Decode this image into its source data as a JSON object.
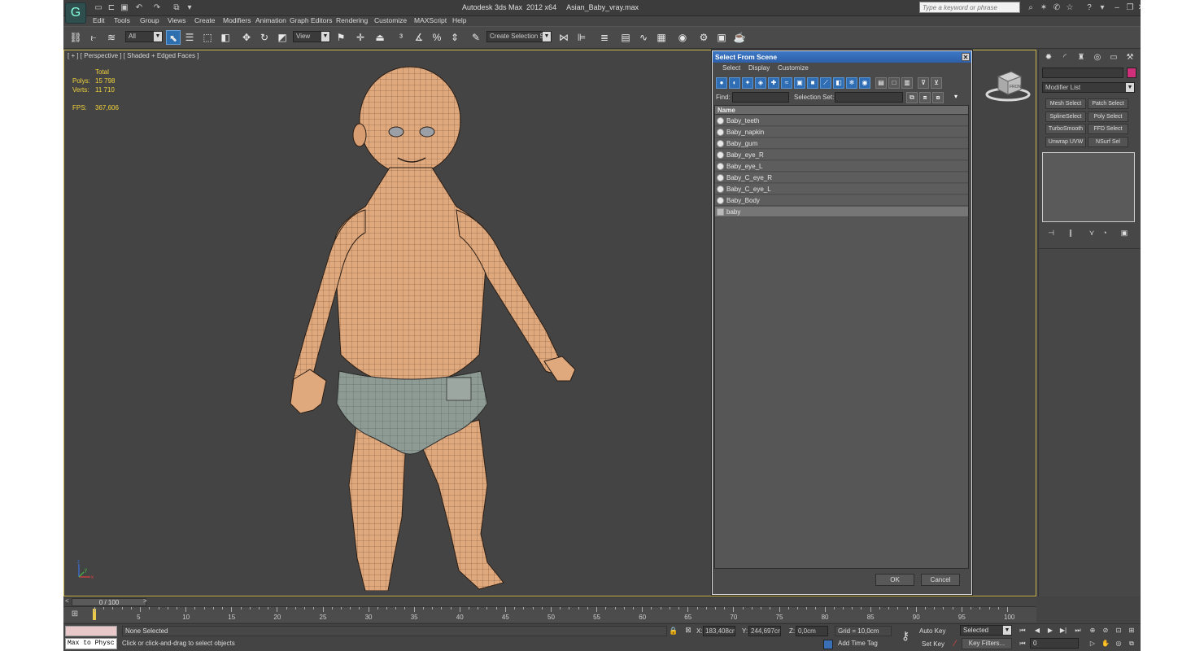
{
  "window": {
    "title": "Autodesk 3ds Max  2012 x64     Asian_Baby_vray.max",
    "search_placeholder": "Type a keyword or phrase",
    "logo_glyph": "G"
  },
  "menu": [
    "Edit",
    "Tools",
    "Group",
    "Views",
    "Create",
    "Modifiers",
    "Animation",
    "Graph Editors",
    "Rendering",
    "Customize",
    "MAXScript",
    "Help"
  ],
  "toolbar": {
    "filter_value": "All",
    "refcoord_value": "View",
    "named_selection_placeholder": "Create Selection Se"
  },
  "viewport": {
    "label": "[ + ] [ Perspective ] [ Shaded + Edged Faces ]",
    "stats": {
      "header": "Total",
      "polys_label": "Polys:",
      "polys_value": "15 798",
      "verts_label": "Verts:",
      "verts_value": "11 710",
      "fps_label": "FPS:",
      "fps_value": "367,606"
    },
    "viewcube_face": "FRONT",
    "axes": [
      "x",
      "y",
      "z"
    ]
  },
  "dialog": {
    "title": "Select From Scene",
    "menu": [
      "Select",
      "Display",
      "Customize"
    ],
    "find_label": "Find:",
    "find_value": "",
    "selection_set_label": "Selection Set:",
    "column_name": "Name",
    "objects": [
      {
        "name": "Baby_teeth",
        "selected": false,
        "type": "mesh"
      },
      {
        "name": "Baby_napkin",
        "selected": false,
        "type": "mesh"
      },
      {
        "name": "Baby_gum",
        "selected": false,
        "type": "mesh"
      },
      {
        "name": "Baby_eye_R",
        "selected": false,
        "type": "mesh"
      },
      {
        "name": "Baby_eye_L",
        "selected": false,
        "type": "mesh"
      },
      {
        "name": "Baby_C_eye_R",
        "selected": false,
        "type": "mesh"
      },
      {
        "name": "Baby_C_eye_L",
        "selected": false,
        "type": "mesh"
      },
      {
        "name": "Baby_Body",
        "selected": false,
        "type": "mesh"
      },
      {
        "name": "baby",
        "selected": true,
        "type": "group"
      }
    ],
    "ok_label": "OK",
    "cancel_label": "Cancel"
  },
  "command_panel": {
    "modifier_list_label": "Modifier List",
    "color_swatch": "#d0307a",
    "modifier_buttons": [
      "Mesh Select",
      "Patch Select",
      "SplineSelect",
      "Poly Select",
      "TurboSmooth",
      "FFD Select",
      "Unwrap UVW",
      "NSurf Sel"
    ]
  },
  "timeline": {
    "slider_label": "0 / 100",
    "ticks": [
      "5",
      "10",
      "15",
      "20",
      "25",
      "30",
      "35",
      "40",
      "45",
      "50",
      "55",
      "60",
      "65",
      "70",
      "75",
      "80",
      "85",
      "90",
      "95",
      "100"
    ]
  },
  "status": {
    "maxscript_listener": "Max to Physc",
    "selection": "None Selected",
    "prompt": "Click or click-and-drag to select objects",
    "x_label": "X:",
    "x_value": "183,408cm",
    "y_label": "Y:",
    "y_value": "244,697cm",
    "z_label": "Z:",
    "z_value": "0,0cm",
    "grid": "Grid = 10,0cm",
    "add_time_tag": "Add Time Tag",
    "auto_key": "Auto Key",
    "set_key": "Set Key",
    "selected_value": "Selected",
    "key_filters": "Key Filters...",
    "current_frame": "0"
  },
  "colors": {
    "accent_blue": "#2e6fb0",
    "viewport_border": "#c8b24a",
    "stats_yellow": "#f2d23a",
    "skin": "#e0a97d",
    "diaper": "#8e9a94"
  }
}
